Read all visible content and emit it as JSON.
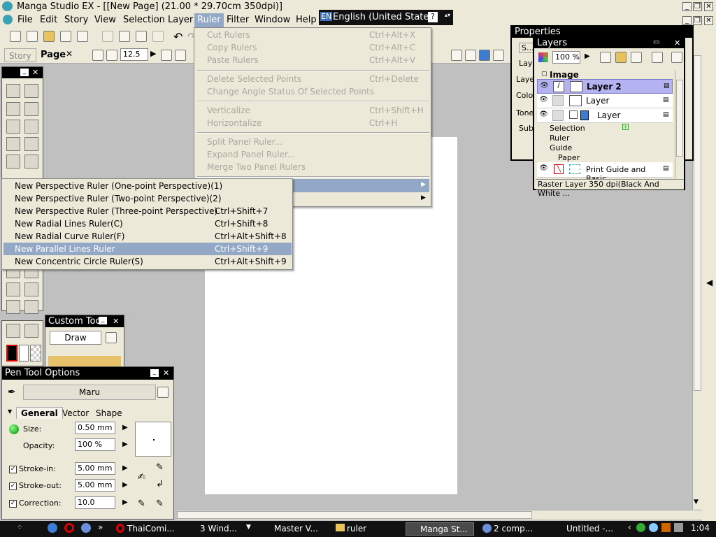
{
  "window": {
    "title": "Manga Studio EX - [[New Page] (21.00 * 29.70cm 350dpi)]"
  },
  "menu": {
    "items": [
      "File",
      "Edit",
      "Story",
      "View",
      "Selection",
      "Layer",
      "Ruler",
      "Filter",
      "Window",
      "Help"
    ],
    "active": "Ruler"
  },
  "language_bar": {
    "code": "EN",
    "name": "English (United States)"
  },
  "tabs": {
    "story": "Story",
    "page": "Page",
    "zoom": "12.5"
  },
  "ruler_menu": {
    "items": [
      {
        "label": "Cut Rulers",
        "shortcut": "Ctrl+Alt+X"
      },
      {
        "label": "Copy Rulers",
        "shortcut": "Ctrl+Alt+C"
      },
      {
        "label": "Paste Rulers",
        "shortcut": "Ctrl+Alt+V"
      },
      {
        "label": "Delete Selected Points",
        "shortcut": "Ctrl+Delete"
      },
      {
        "label": "Change Angle Status Of Selected Points",
        "shortcut": ""
      },
      {
        "label": "Verticalize",
        "shortcut": "Ctrl+Shift+H"
      },
      {
        "label": "Horizontalize",
        "shortcut": "Ctrl+H"
      },
      {
        "label": "Split Panel Ruler...",
        "shortcut": ""
      },
      {
        "label": "Expand Panel Ruler...",
        "shortcut": ""
      },
      {
        "label": "Merge Two Panel Rulers",
        "shortcut": ""
      }
    ]
  },
  "ruler_submenu": {
    "items": [
      {
        "label": "New Perspective Ruler (One-point Perspective)(1)",
        "shortcut": ""
      },
      {
        "label": "New Perspective Ruler (Two-point Perspective)(2)",
        "shortcut": ""
      },
      {
        "label": "New Perspective Ruler (Three-point Perspective)",
        "shortcut": "Ctrl+Shift+7"
      },
      {
        "label": "New Radial Lines Ruler(C)",
        "shortcut": "Ctrl+Shift+8"
      },
      {
        "label": "New Radial Curve Ruler(F)",
        "shortcut": "Ctrl+Alt+Shift+8"
      },
      {
        "label": "New Parallel Lines Ruler",
        "shortcut": "Ctrl+Shift+9"
      },
      {
        "label": "New Concentric Circle Ruler(S)",
        "shortcut": "Ctrl+Alt+Shift+9"
      }
    ],
    "highlighted": 5
  },
  "properties_panel": {
    "title": "Properties",
    "labels": [
      "Laye",
      "Laye",
      "Color",
      "Tone",
      "Sub"
    ],
    "tab": "S..."
  },
  "layers_panel": {
    "title": "Layers",
    "zoom": "100 %",
    "group": "Image",
    "layers": [
      {
        "name": "Layer 2",
        "selected": true
      },
      {
        "name": "Layer",
        "selected": false
      },
      {
        "name": "Layer",
        "selected": false
      }
    ],
    "sections": [
      "Selection",
      "Ruler",
      "Guide",
      "Paper"
    ],
    "paper_layer": "Print Guide and Basic...",
    "status": "Raster Layer 350 dpi(Black And White ..."
  },
  "custom_tool": {
    "title": "Custom Tool",
    "mode": "Draw"
  },
  "pen_options": {
    "title": "Pen Tool Options",
    "brush": "Maru",
    "tabs": [
      "General",
      "Vector",
      "Shape"
    ],
    "size_label": "Size:",
    "size": "0.50 mm",
    "opacity_label": "Opacity:",
    "opacity": "100 %",
    "stroke_in_label": "Stroke-in:",
    "stroke_in": "5.00 mm",
    "stroke_out_label": "Stroke-out:",
    "stroke_out": "5.00 mm",
    "correction_label": "Correction:",
    "correction": "10.0"
  },
  "taskbar": {
    "items": [
      "ThaiComi...",
      "3 Wind...",
      "Master V...",
      "ruler",
      "Manga St...",
      "2 comp...",
      "Untitled -..."
    ],
    "active": 4,
    "clock": "1:04"
  },
  "colors": {
    "highlight": "#93a8c7",
    "selected_layer": "#b4b2f0",
    "chrome": "#ece9d8"
  }
}
